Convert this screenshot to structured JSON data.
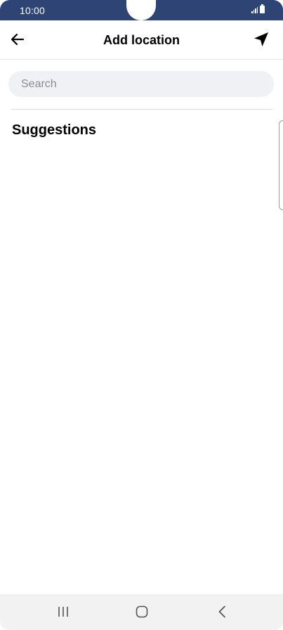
{
  "status_bar": {
    "time": "10:00",
    "icons": [
      "signal-icon",
      "battery-icon"
    ]
  },
  "header": {
    "title": "Add location",
    "back_icon": "arrow-left-icon",
    "location_icon": "navigation-arrow-icon"
  },
  "search": {
    "placeholder": "Search",
    "value": ""
  },
  "suggestions": {
    "title": "Suggestions",
    "items": []
  },
  "nav_bar": {
    "icons": [
      "recents-icon",
      "home-icon",
      "back-icon"
    ]
  },
  "colors": {
    "status_bar": "#2d4475",
    "search_bg": "#f0f1f5",
    "nav_bar_bg": "#f2f2f2",
    "text_primary": "#000000",
    "placeholder": "#8a8d93"
  }
}
